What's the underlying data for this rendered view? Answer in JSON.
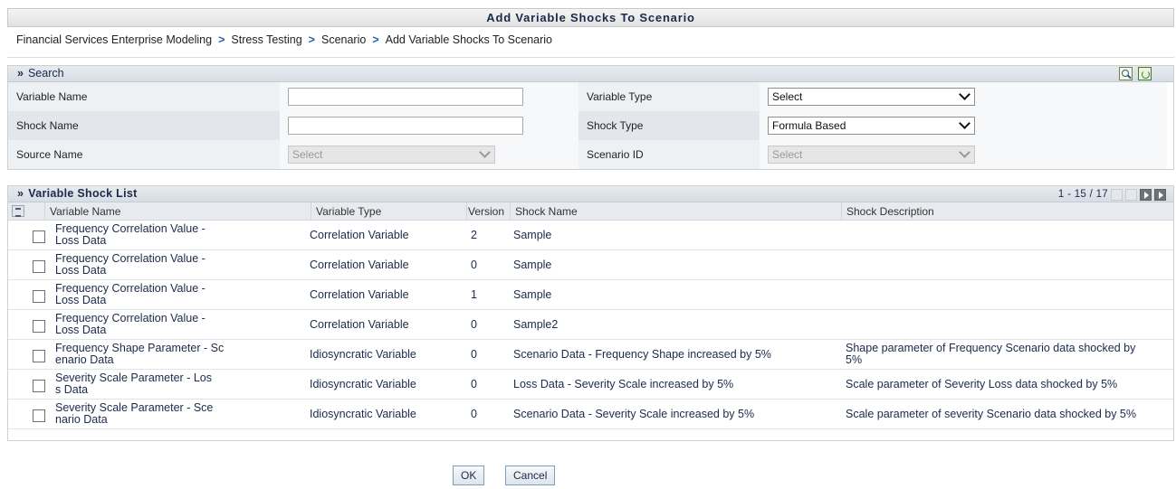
{
  "page": {
    "title": "Add Variable Shocks To Scenario",
    "breadcrumb": [
      "Financial Services Enterprise Modeling",
      "Stress Testing",
      "Scenario",
      "Add Variable Shocks To Scenario"
    ],
    "breadcrumb_separator": ">"
  },
  "search": {
    "heading": "Search",
    "fields": {
      "variable_name": {
        "label": "Variable Name",
        "value": ""
      },
      "variable_type": {
        "label": "Variable Type",
        "value": "Select"
      },
      "shock_name": {
        "label": "Shock Name",
        "value": ""
      },
      "shock_type": {
        "label": "Shock Type",
        "value": "Formula Based"
      },
      "source_name": {
        "label": "Source Name",
        "value": "Select"
      },
      "scenario_id": {
        "label": "Scenario ID",
        "value": "Select"
      }
    },
    "icons": [
      "search-icon",
      "reset-icon"
    ]
  },
  "list": {
    "heading": "Variable Shock List",
    "pagination": "1 - 15 / 17",
    "columns": [
      "Variable Name",
      "Variable Type",
      "Version",
      "Shock Name",
      "Shock Description"
    ],
    "rows": [
      {
        "variable_name": "Frequency Correlation Value -\nLoss Data",
        "variable_type": "Correlation Variable",
        "version": "2",
        "shock_name": "Sample",
        "shock_description": ""
      },
      {
        "variable_name": "Frequency Correlation Value -\nLoss Data",
        "variable_type": "Correlation Variable",
        "version": "0",
        "shock_name": "Sample",
        "shock_description": ""
      },
      {
        "variable_name": "Frequency Correlation Value -\nLoss Data",
        "variable_type": "Correlation Variable",
        "version": "1",
        "shock_name": "Sample",
        "shock_description": ""
      },
      {
        "variable_name": "Frequency Correlation Value -\nLoss Data",
        "variable_type": "Correlation Variable",
        "version": "0",
        "shock_name": "Sample2",
        "shock_description": ""
      },
      {
        "variable_name": "Frequency Shape Parameter - Sc\nenario Data",
        "variable_type": "Idiosyncratic Variable",
        "version": "0",
        "shock_name": "Scenario Data - Frequency Shape increased by 5%",
        "shock_description": "Shape parameter of Frequency Scenario data shocked by\n5%"
      },
      {
        "variable_name": "Severity Scale Parameter - Los\ns Data",
        "variable_type": "Idiosyncratic Variable",
        "version": "0",
        "shock_name": "Loss Data - Severity Scale increased by 5%",
        "shock_description": "Scale parameter of Severity Loss data shocked by 5%"
      },
      {
        "variable_name": "Severity Scale Parameter - Sce\nnario Data",
        "variable_type": "Idiosyncratic Variable",
        "version": "0",
        "shock_name": "Scenario Data - Severity Scale increased by 5%",
        "shock_description": "Scale parameter of severity Scenario data shocked by 5%"
      }
    ]
  },
  "buttons": {
    "ok": "OK",
    "cancel": "Cancel"
  },
  "colors": {
    "accent": "#1f63a8",
    "header_bg": "#e7ebf0"
  }
}
